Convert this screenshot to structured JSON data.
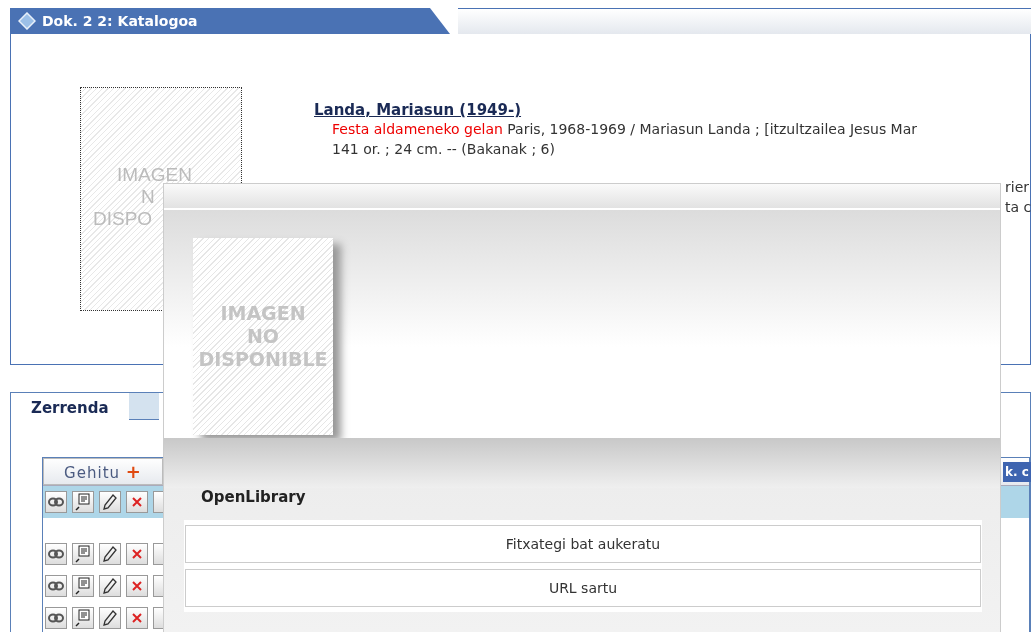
{
  "header": {
    "title": "Dok. 2 2: Katalogoa"
  },
  "record": {
    "image_text": [
      "IMAGEN",
      "N",
      "DISPO"
    ],
    "author": "Landa, Mariasun (1949-)",
    "title": "Festa aldameneko gelan",
    "description": "Paris, 1968-1969 / Mariasun Landa ; [itzultzailea Jesus Mar",
    "extent": "141 or. ; 24 cm. -- (Bakanak ; 6)",
    "note_fragments": [
      "rier",
      "ta c"
    ]
  },
  "tabs": [
    {
      "label": "Zerrenda",
      "selected": true
    }
  ],
  "list": {
    "add_button": "Gehitu",
    "add_symbol": "+",
    "header_fragment": "k. c",
    "rows": [
      {
        "selected": true
      },
      {
        "selected": false
      },
      {
        "selected": false
      },
      {
        "selected": false
      }
    ]
  },
  "dialog": {
    "image_text": [
      "IMAGEN",
      "NO",
      "DISPONIBLE"
    ],
    "section_title": "OpenLibrary",
    "buttons": [
      "Fitxategi bat aukeratu",
      "URL sartu"
    ]
  }
}
